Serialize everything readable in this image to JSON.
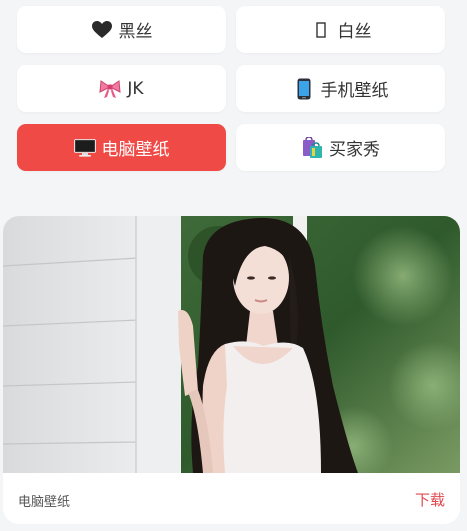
{
  "categories": [
    {
      "label": "黑丝",
      "icon": "black-heart-icon",
      "active": false
    },
    {
      "label": "白丝",
      "icon": "missing-glyph-icon",
      "active": false
    },
    {
      "label": "JK",
      "icon": "ribbon-bow-icon",
      "active": false
    },
    {
      "label": "手机壁纸",
      "icon": "mobile-phone-icon",
      "active": false
    },
    {
      "label": "电脑壁纸",
      "icon": "desktop-computer-icon",
      "active": true
    },
    {
      "label": "买家秀",
      "icon": "shopping-bags-icon",
      "active": false
    }
  ],
  "card": {
    "caption": "电脑壁纸",
    "download_label": "下载"
  },
  "colors": {
    "accent": "#f04a47",
    "download": "#e0484f",
    "background": "#f4f5f7"
  }
}
